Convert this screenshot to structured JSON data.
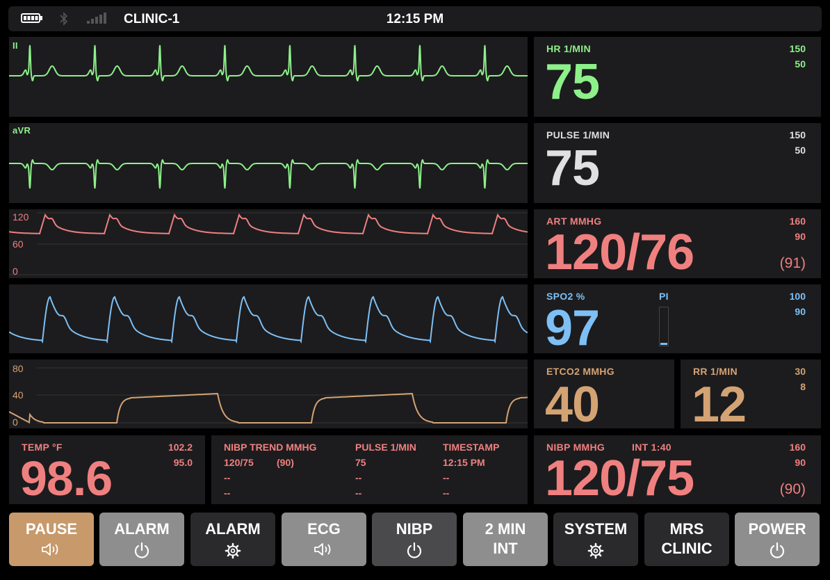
{
  "status_bar": {
    "device_name": "CLINIC-1",
    "time": "12:15 PM",
    "icons": [
      "battery-icon",
      "bluetooth-icon",
      "signal-icon"
    ]
  },
  "waveforms": {
    "ecg_lead_1": {
      "label": "II"
    },
    "ecg_lead_2": {
      "label": "aVR"
    },
    "art": {
      "scale": [
        "120",
        "60",
        "0"
      ]
    },
    "spo2": {},
    "etco2": {
      "scale": [
        "80",
        "40",
        "0"
      ]
    }
  },
  "hr": {
    "label": "HR  1/MIN",
    "value": "75",
    "limit_high": "150",
    "limit_low": "50"
  },
  "pulse": {
    "label": "PULSE  1/MIN",
    "value": "75",
    "limit_high": "150",
    "limit_low": "50"
  },
  "art": {
    "label": "ART  MMHG",
    "value": "120/76",
    "mean": "(91)",
    "limit_high": "160",
    "limit_low": "90"
  },
  "spo2": {
    "label": "SPO2  %",
    "value": "97",
    "pi_label": "PI",
    "pi_level": 0.1,
    "limit_high": "100",
    "limit_low": "90"
  },
  "etco2": {
    "label": "ETCO2  MMHG",
    "value": "40"
  },
  "rr": {
    "label": "RR  1/MIN",
    "value": "12",
    "limit_high": "30",
    "limit_low": "8"
  },
  "temp": {
    "label": "TEMP  °F",
    "value": "98.6",
    "limit_high": "102.2",
    "limit_low": "95.0"
  },
  "nibp_trend": {
    "headers": [
      "NIBP TREND  MMHG",
      "PULSE  1/MIN",
      "TIMESTAMP"
    ],
    "rows": [
      {
        "bp": "120/75",
        "mean": "(90)",
        "pulse": "75",
        "time": "12:15 PM"
      },
      {
        "bp": "--",
        "mean": "",
        "pulse": "--",
        "time": "--"
      },
      {
        "bp": "--",
        "mean": "",
        "pulse": "--",
        "time": "--"
      }
    ]
  },
  "nibp": {
    "label": "NIBP  MMHG",
    "interval": "INT 1:40",
    "value": "120/75",
    "mean": "(90)",
    "limit_high": "160",
    "limit_low": "90"
  },
  "buttons": [
    {
      "line1": "PAUSE",
      "line2": "",
      "icon": "speaker-icon"
    },
    {
      "line1": "ALARM",
      "line2": "",
      "icon": "power-icon"
    },
    {
      "line1": "ALARM",
      "line2": "",
      "icon": "gear-icon"
    },
    {
      "line1": "ECG",
      "line2": "",
      "icon": "speaker-icon"
    },
    {
      "line1": "NIBP",
      "line2": "",
      "icon": "power-icon"
    },
    {
      "line1": "2 MIN",
      "line2": "INT",
      "icon": ""
    },
    {
      "line1": "SYSTEM",
      "line2": "",
      "icon": "gear-icon"
    },
    {
      "line1": "MRS",
      "line2": "CLINIC",
      "icon": ""
    },
    {
      "line1": "POWER",
      "line2": "",
      "icon": "power-icon"
    }
  ],
  "colors": {
    "ecg": "#8ef08a",
    "pulse": "#e0e0e0",
    "art": "#f08080",
    "spo2": "#7ec0f5",
    "co2": "#d4a373",
    "pause_button": "#c8996a"
  }
}
